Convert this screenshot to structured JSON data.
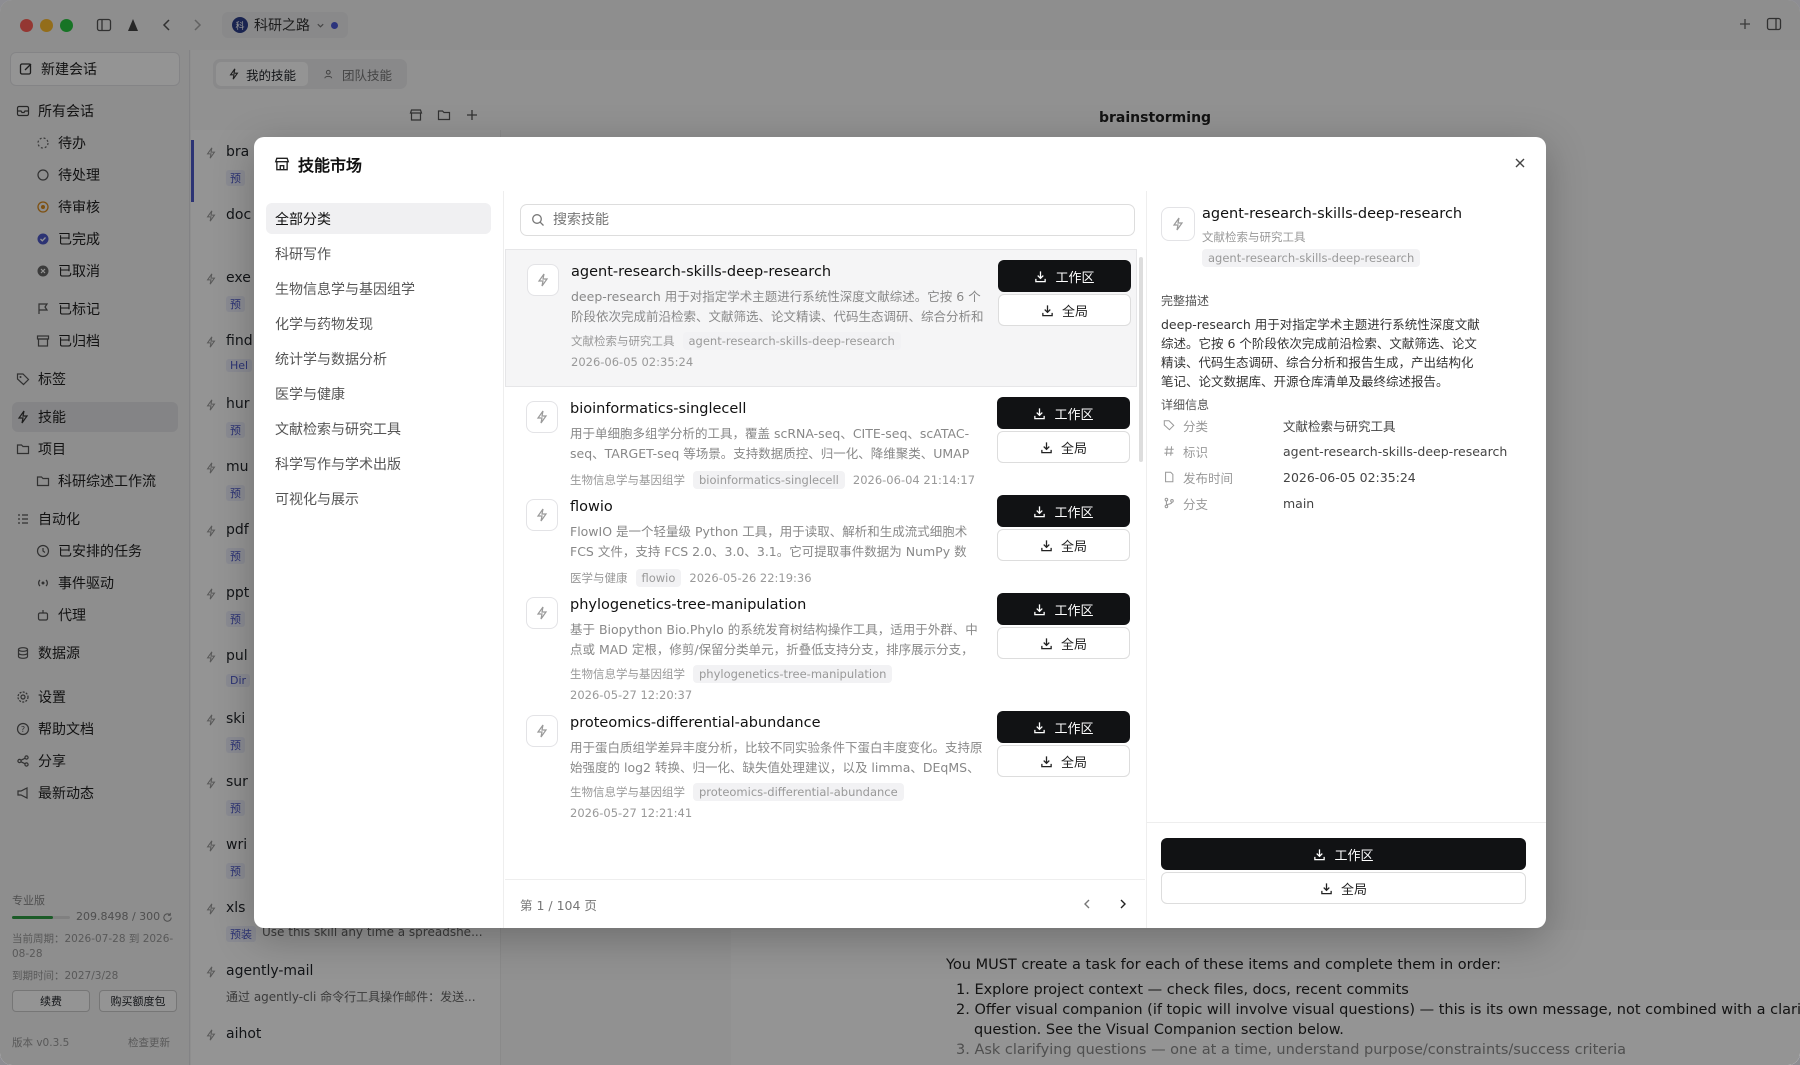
{
  "window": {
    "workspace_name": "科研之路"
  },
  "sidebar": {
    "new_chat": "新建会话",
    "all_chats": "所有会话",
    "status_items": [
      {
        "label": "待办",
        "icon": "dashed-circle-icon"
      },
      {
        "label": "待处理",
        "icon": "circle-icon"
      },
      {
        "label": "待审核",
        "icon": "review-circle-icon"
      },
      {
        "label": "已完成",
        "icon": "check-circle-icon"
      },
      {
        "label": "已取消",
        "icon": "x-circle-icon"
      }
    ],
    "flagged": "已标记",
    "archived": "已归档",
    "tags": "标签",
    "skills": "技能",
    "projects": "项目",
    "project_items": [
      "科研综述工作流"
    ],
    "automation": "自动化",
    "automation_items": [
      "已安排的任务",
      "事件驱动",
      "代理"
    ],
    "datasource": "数据源",
    "settings": "设置",
    "help": "帮助文档",
    "share": "分享",
    "news": "最新动态",
    "plan": {
      "name": "专业版",
      "usage": "209.8498 / 300",
      "usage_fraction": 0.7,
      "period": "当前周期：2026-07-28 到 2026-08-28",
      "expire": "到期时间：2027/3/28",
      "renew": "续费",
      "buy": "购买额度包"
    },
    "version": "版本 v0.3.5",
    "check_update": "检查更新"
  },
  "main_bg": {
    "tabs": [
      "我的技能",
      "团队技能"
    ],
    "header_title": "brainstorming",
    "list_rows": [
      {
        "name": "bra",
        "badge": "预"
      },
      {
        "name": "doc",
        "badge": ""
      },
      {
        "name": "exe",
        "badge": "预"
      },
      {
        "name": "find",
        "badge": "Hel"
      },
      {
        "name": "hur",
        "badge": "预"
      },
      {
        "name": "mu",
        "badge": "预"
      },
      {
        "name": "pdf",
        "badge": "预"
      },
      {
        "name": "ppt",
        "badge": "预"
      },
      {
        "name": "pul",
        "badge": "Dir"
      },
      {
        "name": "ski",
        "badge": "预"
      },
      {
        "name": "sur",
        "badge": "预"
      },
      {
        "name": "wri",
        "badge": "预"
      },
      {
        "name": "xls",
        "badge": "预装"
      },
      {
        "name": "agently-mail",
        "badge": ""
      },
      {
        "name": "aihot",
        "badge": ""
      }
    ],
    "xls_desc": "Use this skill any time a spreadshe...",
    "agently_desc": "通过 agently-cli 命令行工具操作邮件：发送...",
    "content_lines": [
      "You MUST create a task for each of these items and complete them in order:",
      "1. Explore project context — check files, docs, recent commits",
      "2. Offer visual companion (if topic will involve visual questions) — this is its own message, not combined with a clarifying",
      "question. See the Visual Companion section below.",
      "3. Ask clarifying questions — one at a time, understand purpose/constraints/success criteria"
    ]
  },
  "modal": {
    "title": "技能市场",
    "search_placeholder": "搜索技能",
    "categories": [
      "全部分类",
      "科研写作",
      "生物信息学与基因组学",
      "化学与药物发现",
      "统计学与数据分析",
      "医学与健康",
      "文献检索与研究工具",
      "科学写作与学术出版",
      "可视化与展示"
    ],
    "btn_workspace": "工作区",
    "btn_global": "全局",
    "skills": [
      {
        "name": "agent-research-skills-deep-research",
        "desc": "deep-research 用于对指定学术主题进行系统性深度文献综述。它按 6 个阶段依次完成前沿检索、文献筛选、论文精读、代码生态调研、综合分析和报告生...",
        "category": "文献检索与研究工具",
        "tag": "agent-research-skills-deep-research",
        "date": "2026-06-05 02:35:24"
      },
      {
        "name": "bioinformatics-singlecell",
        "desc": "用于单细胞多组学分析的工具，覆盖 scRNA-seq、CITE-seq、scATAC-seq、TARGET-seq 等场景。支持数据质控、归一化、降维聚类、UMAP 可视化、...",
        "category": "生物信息学与基因组学",
        "tag": "bioinformatics-singlecell",
        "date": "2026-06-04 21:14:17"
      },
      {
        "name": "flowio",
        "desc": "FlowIO 是一个轻量级 Python 工具，用于读取、解析和生成流式细胞术 FCS 文件，支持 FCS 2.0、3.0、3.1。它可提取事件数据为 NumPy 数组，读取元数...",
        "category": "医学与健康",
        "tag": "flowio",
        "date": "2026-05-26 22:19:36"
      },
      {
        "name": "phylogenetics-tree-manipulation",
        "desc": "基于 Biopython Bio.Phylo 的系统发育树结构操作工具，适用于外群、中点或 MAD 定根，修剪/保留分类单元，折叠低支持分支，排序展示分支，提取子树...",
        "category": "生物信息学与基因组学",
        "tag": "phylogenetics-tree-manipulation",
        "date": "2026-05-27 12:20:37"
      },
      {
        "name": "proteomics-differential-abundance",
        "desc": "用于蛋白质组学差异丰度分析，比较不同实验条件下蛋白丰度变化。支持原始强度的 log2 转换、归一化、缺失值处理建议，以及 limma、DEqMS、proDA ...",
        "category": "生物信息学与基因组学",
        "tag": "proteomics-differential-abundance",
        "date": "2026-05-27 12:21:41"
      }
    ],
    "pager": "第 1 / 104 页",
    "detail": {
      "name": "agent-research-skills-deep-research",
      "category": "文献检索与研究工具",
      "tag": "agent-research-skills-deep-research",
      "full_desc_title": "完整描述",
      "full_desc": "deep-research 用于对指定学术主题进行系统性深度文献综述。它按 6 个阶段依次完成前沿检索、文献筛选、论文精读、代码生态调研、综合分析和报告生成，产出结构化笔记、论文数据库、开源仓库清单及最终综述报告。",
      "info_title": "详细信息",
      "rows": [
        {
          "key": "分类",
          "value": "文献检索与研究工具",
          "icon": "tag-icon"
        },
        {
          "key": "标识",
          "value": "agent-research-skills-deep-research",
          "icon": "hash-icon"
        },
        {
          "key": "发布时间",
          "value": "2026-06-05 02:35:24",
          "icon": "document-icon"
        },
        {
          "key": "分支",
          "value": "main",
          "icon": "branch-icon"
        }
      ]
    }
  }
}
